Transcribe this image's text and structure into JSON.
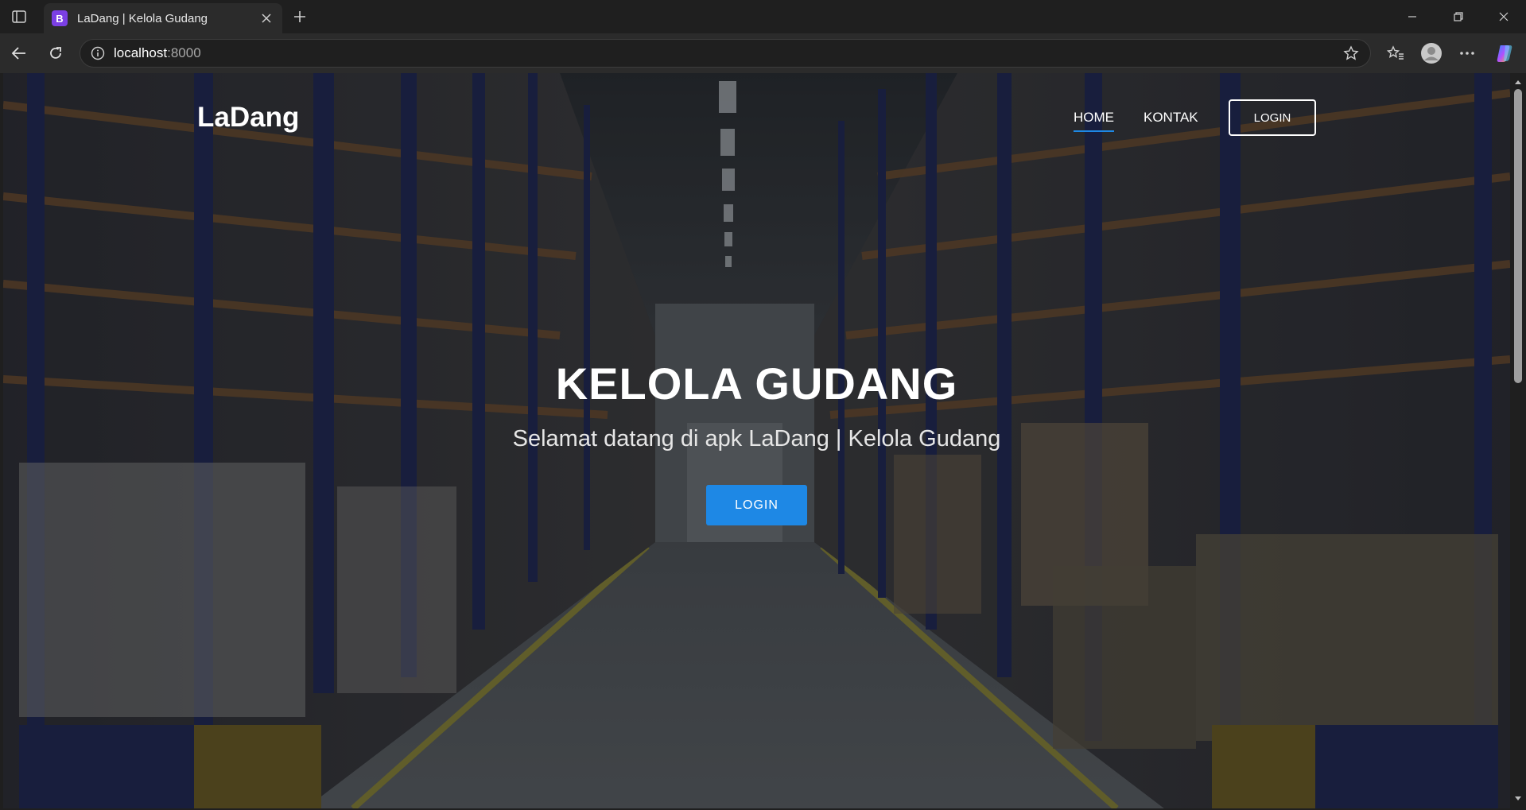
{
  "browser": {
    "tab": {
      "favicon_letter": "B",
      "title": "LaDang | Kelola Gudang"
    },
    "address": {
      "host": "localhost",
      "port": ":8000"
    },
    "icons": [
      "sidebar-toggle-icon",
      "close-icon",
      "plus-icon",
      "minimize-icon",
      "restore-icon",
      "back-icon",
      "reload-icon",
      "info-icon",
      "star-icon",
      "favorites-icon",
      "profile-icon",
      "more-icon",
      "copilot-icon"
    ]
  },
  "page": {
    "brand": "LaDang",
    "nav": {
      "home": "HOME",
      "kontak": "KONTAK",
      "login": "LOGIN"
    },
    "hero": {
      "title": "KELOLA GUDANG",
      "subtitle": "Selamat datang di apk LaDang | Kelola Gudang",
      "button": "LOGIN"
    },
    "colors": {
      "accent": "#1e88e5",
      "nav_underline": "#1e88e5"
    }
  }
}
